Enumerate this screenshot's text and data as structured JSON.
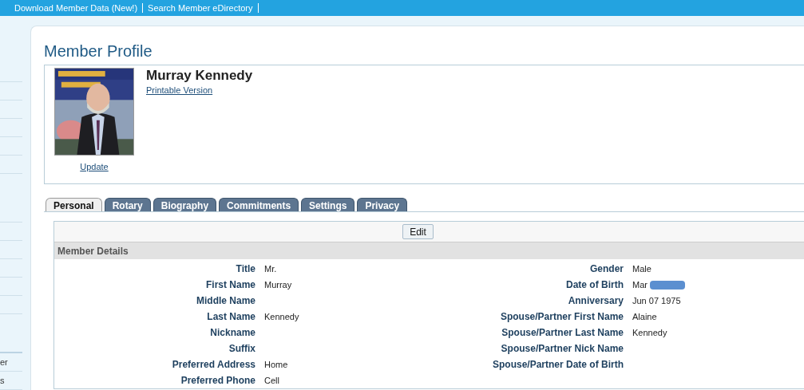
{
  "top_nav": [
    {
      "label": "Download Member Data (New!)"
    },
    {
      "label": "Search Member eDirectory"
    }
  ],
  "sidebar": {
    "items": [
      {
        "label": "er"
      },
      {
        "label": "s"
      }
    ]
  },
  "page_title": "Member Profile",
  "member": {
    "update_link": "Update",
    "name": "Murray Kennedy",
    "printable_link": "Printable Version"
  },
  "tabs": [
    {
      "label": "Personal",
      "selected": true
    },
    {
      "label": "Rotary",
      "selected": false
    },
    {
      "label": "Biography",
      "selected": false
    },
    {
      "label": "Commitments",
      "selected": false
    },
    {
      "label": "Settings",
      "selected": false
    },
    {
      "label": "Privacy",
      "selected": false
    }
  ],
  "edit_button": "Edit",
  "section_title": "Member Details",
  "left_fields": [
    {
      "label": "Title",
      "value": "Mr."
    },
    {
      "label": "First Name",
      "value": "Murray"
    },
    {
      "label": "Middle Name"
    },
    {
      "label": "Last Name",
      "value": "Kennedy"
    },
    {
      "label": "Nickname"
    },
    {
      "label": "Suffix"
    },
    {
      "label": "Preferred Address",
      "value": "Home"
    },
    {
      "label": "Preferred Phone",
      "value": "Cell"
    }
  ],
  "right_fields": [
    {
      "label": "Gender",
      "value": "Male"
    },
    {
      "label": "Date of Birth",
      "value": "Mar",
      "redacted": true
    },
    {
      "label": "Anniversary",
      "value": "Jun 07 1975"
    },
    {
      "label": "Spouse/Partner First Name",
      "value": "Alaine"
    },
    {
      "label": "Spouse/Partner Last Name",
      "value": "Kennedy"
    },
    {
      "label": "Spouse/Partner Nick Name"
    },
    {
      "label": "Spouse/Partner Date of Birth"
    }
  ]
}
